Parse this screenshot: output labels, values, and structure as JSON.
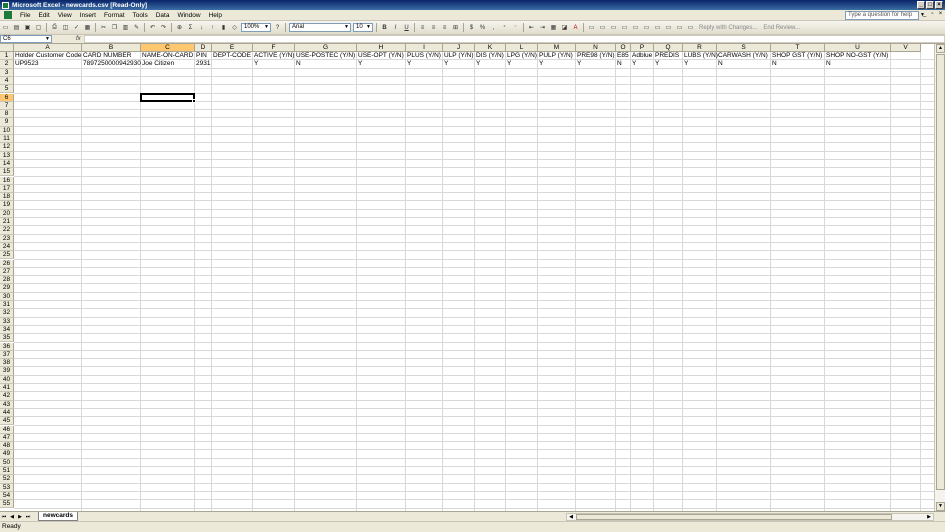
{
  "window": {
    "title": "Microsoft Excel - newcards.csv  [Read-Only]"
  },
  "menu": [
    "File",
    "Edit",
    "View",
    "Insert",
    "Format",
    "Tools",
    "Data",
    "Window",
    "Help"
  ],
  "help_placeholder": "Type a question for help",
  "toolbar": {
    "zoom": "100%",
    "font": "Arial",
    "font_size": "10",
    "bold": "B",
    "italic": "I",
    "underline": "U",
    "currency": "$",
    "percent": "%",
    "reply_label": "Reply with Changes...",
    "end_review_label": "End Review..."
  },
  "formula_bar": {
    "name_box": "C6",
    "fx": "fx",
    "formula": ""
  },
  "grid": {
    "columns": [
      {
        "letter": "A",
        "w": 68
      },
      {
        "letter": "B",
        "w": 59
      },
      {
        "letter": "C",
        "w": 54
      },
      {
        "letter": "D",
        "w": 17
      },
      {
        "letter": "E",
        "w": 41
      },
      {
        "letter": "F",
        "w": 42
      },
      {
        "letter": "G",
        "w": 62
      },
      {
        "letter": "H",
        "w": 49
      },
      {
        "letter": "I",
        "w": 37
      },
      {
        "letter": "J",
        "w": 32
      },
      {
        "letter": "K",
        "w": 31
      },
      {
        "letter": "L",
        "w": 32
      },
      {
        "letter": "M",
        "w": 38
      },
      {
        "letter": "N",
        "w": 40
      },
      {
        "letter": "O",
        "w": 15
      },
      {
        "letter": "P",
        "w": 23
      },
      {
        "letter": "Q",
        "w": 29
      },
      {
        "letter": "R",
        "w": 34
      },
      {
        "letter": "S",
        "w": 54
      },
      {
        "letter": "T",
        "w": 54
      },
      {
        "letter": "U",
        "w": 66
      },
      {
        "letter": "V",
        "w": 30
      }
    ],
    "row_count": 55,
    "active_row": 6,
    "active_col": 2,
    "rows": [
      [
        "Holder Customer Code",
        "CARD NUMBER",
        "NAME-ON-CARD",
        "PIN",
        "DEPT-CODE",
        "ACTIVE (Y/N)",
        "USE-POSTEC (Y/N)",
        "USE-OPT (Y/N)",
        "PLUS (Y/N)",
        "ULP (Y/N)",
        "DIS (Y/N)",
        "LPG (Y/N)",
        "PULP (Y/N)",
        "PRE98 (Y/N)",
        "E85",
        "Adblue",
        "PREDIS",
        "LUBS (Y/N)",
        "CARWASH (Y/N)",
        "SHOP GST (Y/N)",
        "SHOP NO-GST (Y/N)",
        ""
      ],
      [
        "UP9523",
        "7897250000942930",
        "Joe Citizen",
        "2931",
        "",
        "Y",
        "N",
        "Y",
        "Y",
        "Y",
        "Y",
        "Y",
        "Y",
        "Y",
        "N",
        "Y",
        "Y",
        "Y",
        "N",
        "N",
        "N",
        ""
      ]
    ]
  },
  "sheet_tab": "newcards",
  "status": "Ready"
}
